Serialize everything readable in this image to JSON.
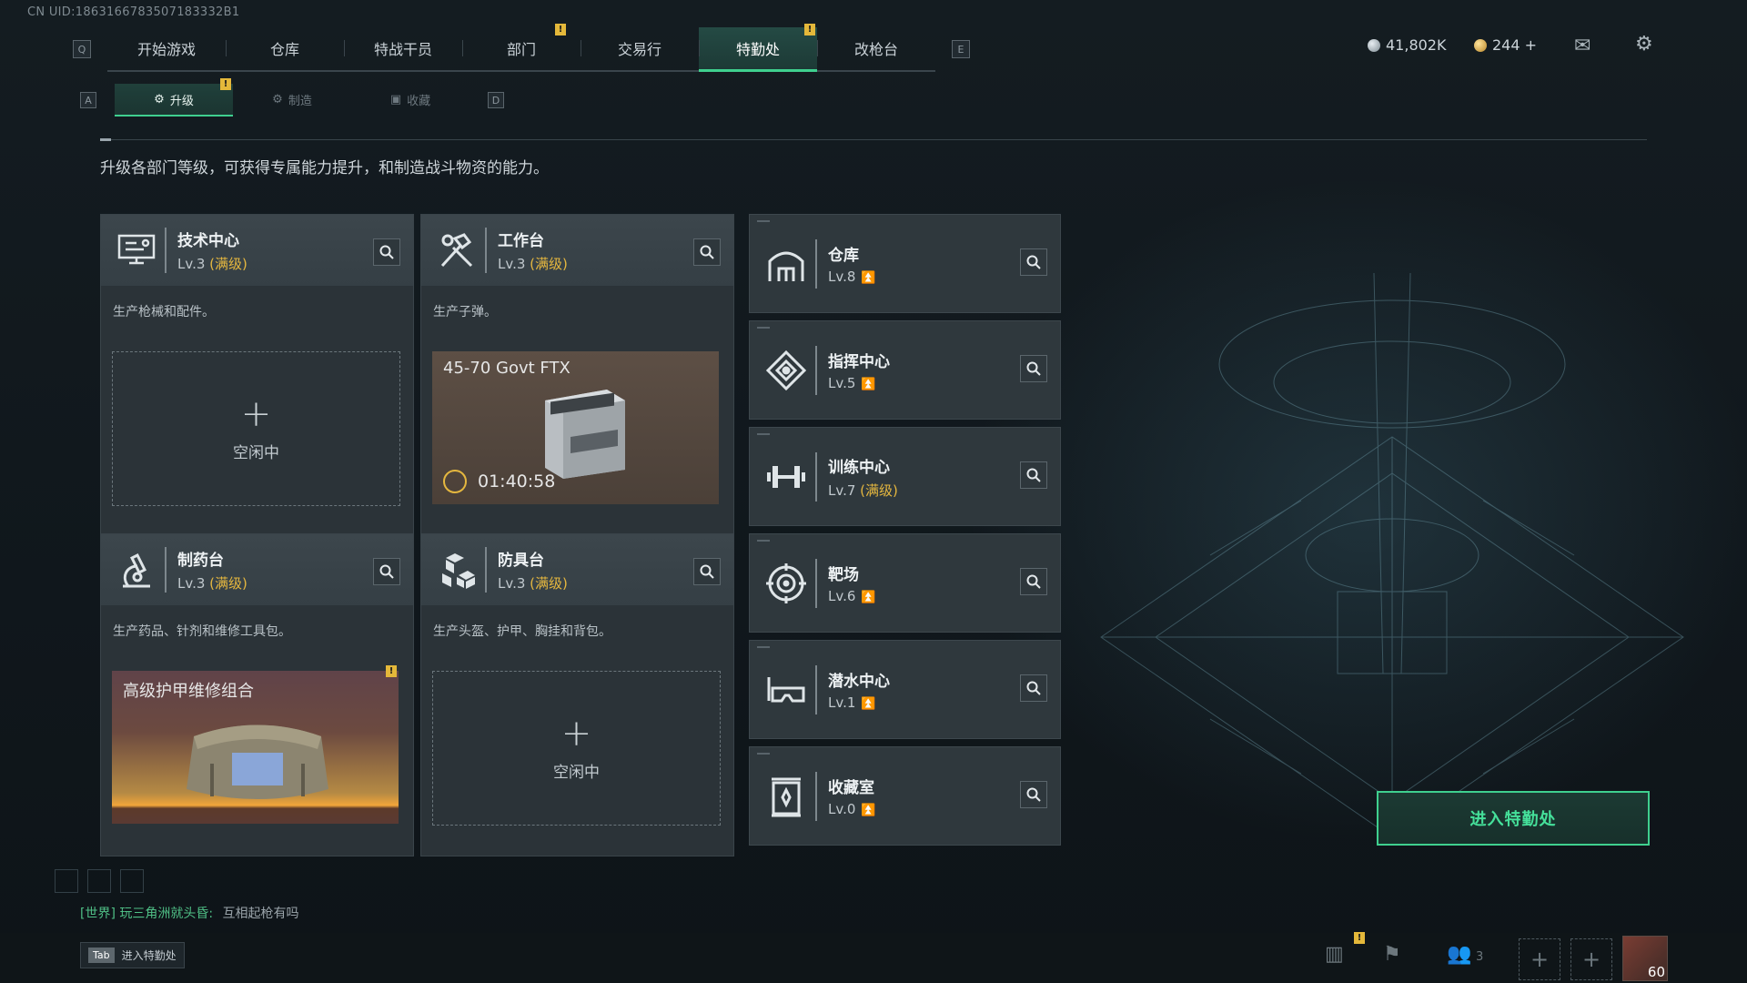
{
  "uid": "CN UID:1863166783507183332B1",
  "top_nav": {
    "hint_left": "Q",
    "hint_right": "E",
    "tabs": [
      {
        "label": "开始游戏"
      },
      {
        "label": "仓库"
      },
      {
        "label": "特战干员"
      },
      {
        "label": "部门",
        "badge": "!"
      },
      {
        "label": "交易行"
      },
      {
        "label": "特勤处",
        "active": true,
        "badge": "!"
      },
      {
        "label": "改枪台"
      }
    ]
  },
  "currency": {
    "primary": "41,802K",
    "secondary": "244 +"
  },
  "sub_nav": {
    "hint_left": "A",
    "hint_right": "D",
    "tabs": [
      {
        "label": "升级",
        "active": true,
        "badge": "!"
      },
      {
        "label": "制造"
      },
      {
        "label": "收藏"
      }
    ]
  },
  "description": "升级各部门等级，可获得专属能力提升，和制造战斗物资的能力。",
  "cards": [
    {
      "title": "技术中心",
      "lv_prefix": "Lv.3",
      "lv_tag": "(满级)",
      "desc": "生产枪械和配件。",
      "slot": {
        "state": "空闲中"
      }
    },
    {
      "title": "工作台",
      "lv_prefix": "Lv.3",
      "lv_tag": "(满级)",
      "desc": "生产子弹。",
      "slot": {
        "item": "45-70 Govt FTX",
        "timer": "01:40:58"
      }
    },
    {
      "title": "制药台",
      "lv_prefix": "Lv.3",
      "lv_tag": "(满级)",
      "desc": "生产药品、针剂和维修工具包。",
      "slot": {
        "item": "高级护甲维修组合",
        "badge": "!"
      }
    },
    {
      "title": "防具台",
      "lv_prefix": "Lv.3",
      "lv_tag": "(满级)",
      "desc": "生产头盔、护甲、胸挂和背包。",
      "slot": {
        "state": "空闲中"
      }
    }
  ],
  "facilities": [
    {
      "title": "仓库",
      "lv": "Lv.8",
      "upgrade": true
    },
    {
      "title": "指挥中心",
      "lv": "Lv.5",
      "upgrade": true
    },
    {
      "title": "训练中心",
      "lv": "Lv.7",
      "tag": "(满级)"
    },
    {
      "title": "靶场",
      "lv": "Lv.6",
      "upgrade": true
    },
    {
      "title": "潜水中心",
      "lv": "Lv.1",
      "upgrade": true
    },
    {
      "title": "收藏室",
      "lv": "Lv.0",
      "upgrade": true
    }
  ],
  "enter_button": "进入特勤处",
  "chat": {
    "channel": "[世界]",
    "user": "玩三角洲就头昏:",
    "message": "互相起枪有吗"
  },
  "bottom": {
    "tab_key": "Tab",
    "tab_label": "进入特勤处",
    "friends_count": "3",
    "level": "60",
    "badge": "!"
  },
  "colors": {
    "accent_green": "#3fd08f",
    "gold": "#e5b73f",
    "panel": "#2b3338"
  }
}
